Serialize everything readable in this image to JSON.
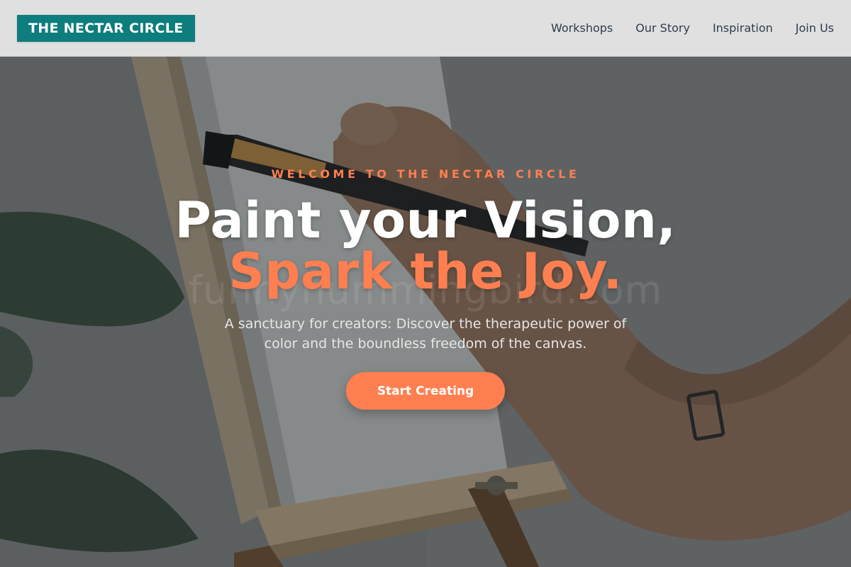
{
  "header": {
    "brand": "THE NECTAR CIRCLE",
    "nav": [
      {
        "label": "Workshops"
      },
      {
        "label": "Our Story"
      },
      {
        "label": "Inspiration"
      },
      {
        "label": "Join Us"
      }
    ]
  },
  "hero": {
    "eyebrow": "WELCOME TO THE NECTAR CIRCLE",
    "headline_line1": "Paint your Vision,",
    "headline_line2": "Spark the Joy.",
    "watermark": "funnyhummingbird.com",
    "subtitle": "A sanctuary for creators: Discover the therapeutic power of color and the boundless freedom of the canvas.",
    "cta_label": "Start Creating"
  },
  "colors": {
    "brand_teal": "#0d7d7d",
    "accent_coral": "#ff7f50",
    "nav_text": "#2f3b4a"
  }
}
